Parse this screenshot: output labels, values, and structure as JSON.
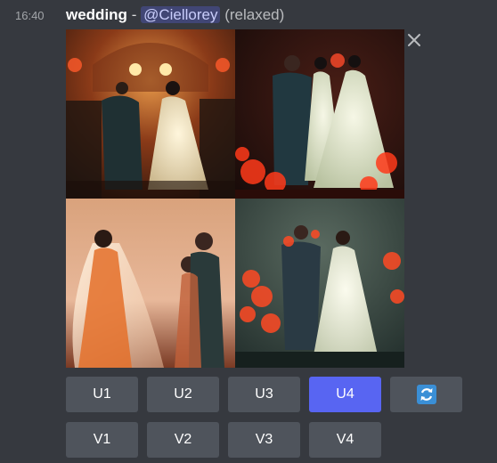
{
  "message": {
    "timestamp": "16:40",
    "prompt": "wedding",
    "separator": "-",
    "mention": "@Ciellorey",
    "mode": "(relaxed)"
  },
  "image_grid": {
    "tiles": [
      {
        "name": "grid-image-1",
        "icon": "wedding-painting-hall"
      },
      {
        "name": "grid-image-2",
        "icon": "wedding-painting-red"
      },
      {
        "name": "grid-image-3",
        "icon": "wedding-painting-veil"
      },
      {
        "name": "grid-image-4",
        "icon": "wedding-painting-garden"
      }
    ]
  },
  "buttons": {
    "upscale": [
      "U1",
      "U2",
      "U3",
      "U4"
    ],
    "variation": [
      "V1",
      "V2",
      "V3",
      "V4"
    ],
    "reroll_icon": "refresh-icon",
    "active": "U4"
  },
  "colors": {
    "background": "#36393f",
    "button": "#4f545c",
    "button_active": "#5865f2",
    "mention_bg": "#414675",
    "reroll_icon": "#3a8fd6"
  }
}
